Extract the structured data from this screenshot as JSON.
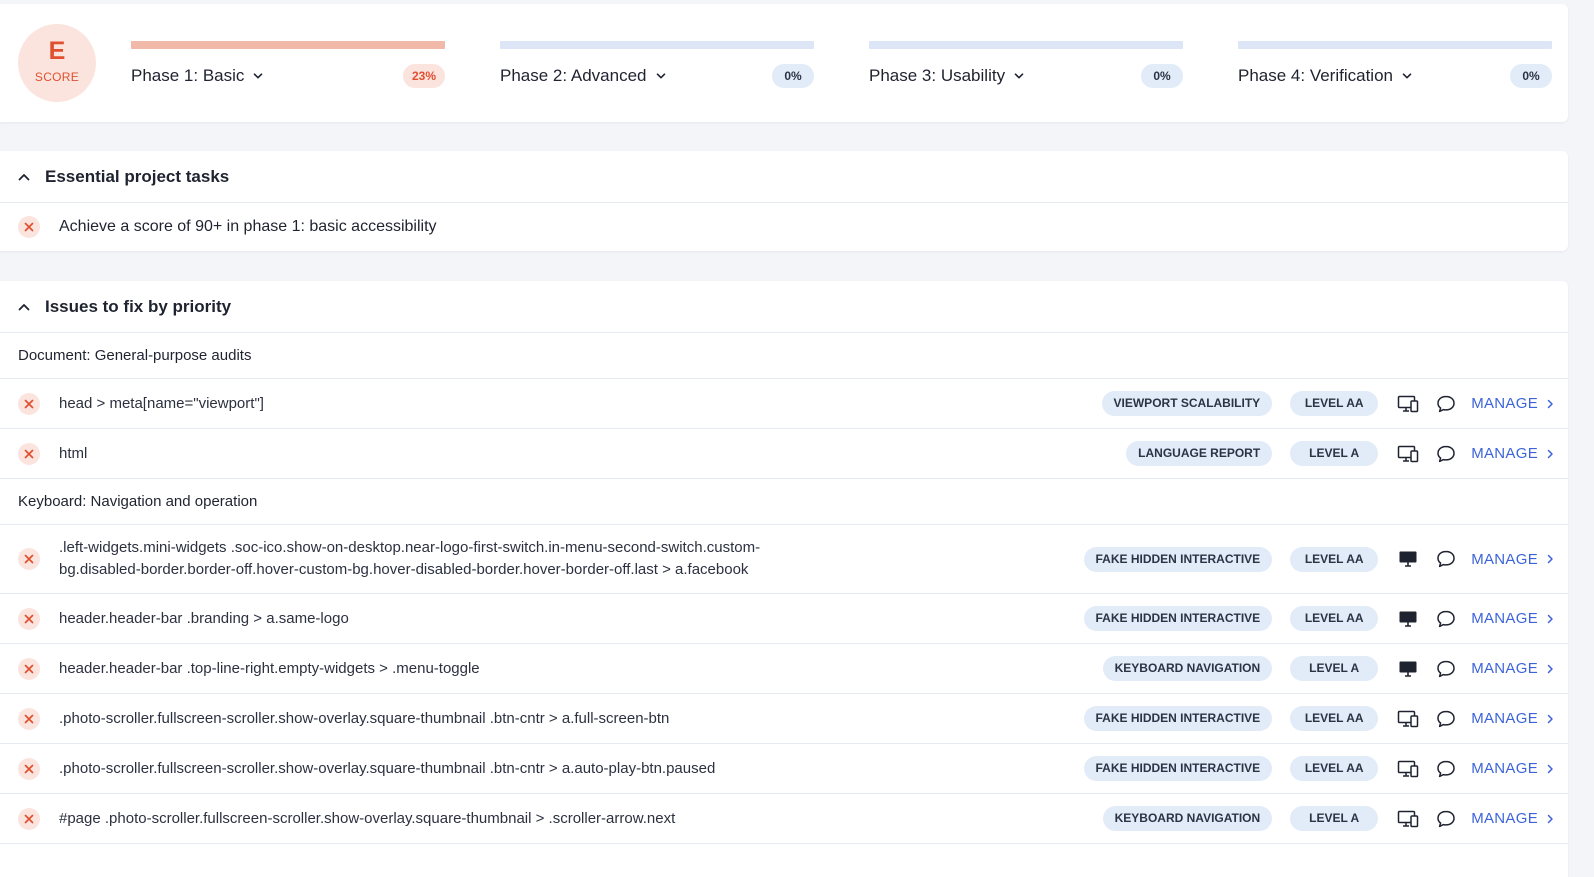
{
  "score": {
    "letter": "E",
    "label": "SCORE"
  },
  "phases": [
    {
      "title": "Phase 1: Basic",
      "percent": "23%",
      "progress": 1.0,
      "fill": "#f0b9a8",
      "badge_bg": "#fbe4de",
      "badge_fg": "#e0502f"
    },
    {
      "title": "Phase 2: Advanced",
      "percent": "0%",
      "progress": 0,
      "fill": "#dde6f6",
      "badge_bg": "#e2ebf8",
      "badge_fg": "#2c3345"
    },
    {
      "title": "Phase 3: Usability",
      "percent": "0%",
      "progress": 0,
      "fill": "#dde6f6",
      "badge_bg": "#e2ebf8",
      "badge_fg": "#2c3345"
    },
    {
      "title": "Phase 4: Verification",
      "percent": "0%",
      "progress": 0,
      "fill": "#dde6f6",
      "badge_bg": "#e2ebf8",
      "badge_fg": "#2c3345"
    }
  ],
  "tasks": {
    "title": "Essential project tasks",
    "items": [
      {
        "text": "Achieve a score of 90+ in phase 1: basic accessibility"
      }
    ]
  },
  "issues": {
    "title": "Issues to fix by priority",
    "manage_label": "MANAGE",
    "groups": [
      {
        "label": "Document: General-purpose audits",
        "items": [
          {
            "selector": "head > meta[name=\"viewport\"]",
            "category": "VIEWPORT SCALABILITY",
            "level": "LEVEL AA",
            "device_icon": "desktop-mobile-icon"
          },
          {
            "selector": "html",
            "category": "LANGUAGE REPORT",
            "level": "LEVEL A",
            "device_icon": "desktop-mobile-icon"
          }
        ]
      },
      {
        "label": "Keyboard: Navigation and operation",
        "items": [
          {
            "selector": ".left-widgets.mini-widgets .soc-ico.show-on-desktop.near-logo-first-switch.in-menu-second-switch.custom-bg.disabled-border.border-off.hover-custom-bg.hover-disabled-border.hover-border-off.last > a.facebook",
            "category": "FAKE HIDDEN INTERACTIVE",
            "level": "LEVEL AA",
            "device_icon": "desktop-icon"
          },
          {
            "selector": "header.header-bar .branding > a.same-logo",
            "category": "FAKE HIDDEN INTERACTIVE",
            "level": "LEVEL AA",
            "device_icon": "desktop-icon"
          },
          {
            "selector": "header.header-bar .top-line-right.empty-widgets > .menu-toggle",
            "category": "KEYBOARD NAVIGATION",
            "level": "LEVEL A",
            "device_icon": "desktop-icon"
          },
          {
            "selector": ".photo-scroller.fullscreen-scroller.show-overlay.square-thumbnail .btn-cntr > a.full-screen-btn",
            "category": "FAKE HIDDEN INTERACTIVE",
            "level": "LEVEL AA",
            "device_icon": "desktop-mobile-icon"
          },
          {
            "selector": ".photo-scroller.fullscreen-scroller.show-overlay.square-thumbnail .btn-cntr > a.auto-play-btn.paused",
            "category": "FAKE HIDDEN INTERACTIVE",
            "level": "LEVEL AA",
            "device_icon": "desktop-mobile-icon"
          },
          {
            "selector": "#page .photo-scroller.fullscreen-scroller.show-overlay.square-thumbnail > .scroller-arrow.next",
            "category": "KEYBOARD NAVIGATION",
            "level": "LEVEL A",
            "device_icon": "desktop-mobile-icon"
          }
        ]
      }
    ]
  }
}
